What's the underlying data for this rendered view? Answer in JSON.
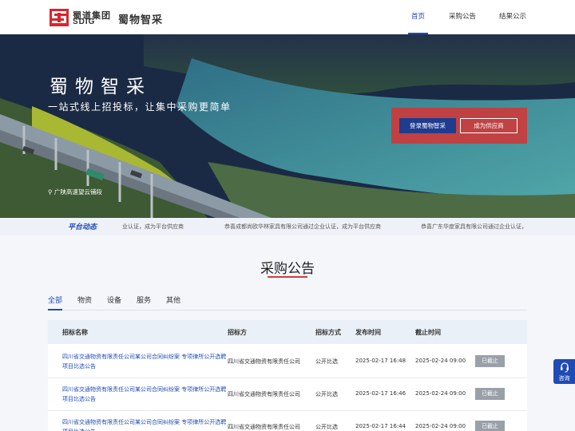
{
  "header": {
    "logo_cn": "蜀道集团",
    "logo_en": "SDIG",
    "brand": "蜀物智采",
    "nav": [
      "首页",
      "采购公告",
      "结果公示"
    ]
  },
  "hero": {
    "title": "蜀物智采",
    "subtitle": "一站式线上招投标，让集中采购更简单",
    "location": "广陕高速望云铺段",
    "login_button": "登录蜀物智采",
    "supplier_button": "成为供应商"
  },
  "ticker": {
    "title": "平台动态",
    "items": [
      "业认证，成为平台供应商",
      "恭喜成都尚欧华林家具有限公司通过企业认证，成为平台供应商",
      "恭喜广东华度家具有限公司通过企业认证，"
    ]
  },
  "section": {
    "title": "采购公告",
    "tabs": [
      "全部",
      "物资",
      "设备",
      "服务",
      "其他"
    ]
  },
  "table": {
    "headers": [
      "招标名称",
      "招标方",
      "招标方式",
      "发布时间",
      "截止时间"
    ],
    "rows": [
      {
        "name": "四川省交通物资有限责任公司某公司合同纠纷案 专项律所公开选聘项目比选公告",
        "org": "四川省交通物资有限责任公司",
        "method": "公开比选",
        "publish": "2025-02-17 16:48",
        "deadline": "2025-02-24 09:00",
        "status": "已截止"
      },
      {
        "name": "四川省交通物资有限责任公司某公司合同纠纷案 专项律所公开选聘项目比选公告",
        "org": "四川省交通物资有限责任公司",
        "method": "公开比选",
        "publish": "2025-02-17 16:46",
        "deadline": "2025-02-24 09:00",
        "status": "已截止"
      },
      {
        "name": "四川省交通物资有限责任公司某公司合同纠纷案 专项律所公开选聘项目比选公告",
        "org": "四川省交通物资有限责任公司",
        "method": "公开比选",
        "publish": "2025-02-17 16:44",
        "deadline": "2025-02-24 09:00",
        "status": "已截止"
      }
    ]
  },
  "side": {
    "consult_label": "咨询"
  },
  "colors": {
    "primary": "#1f4bb5",
    "accent_red": "#d63a3a",
    "login_box": "#d63434",
    "status_gray": "#9aa0a8"
  }
}
